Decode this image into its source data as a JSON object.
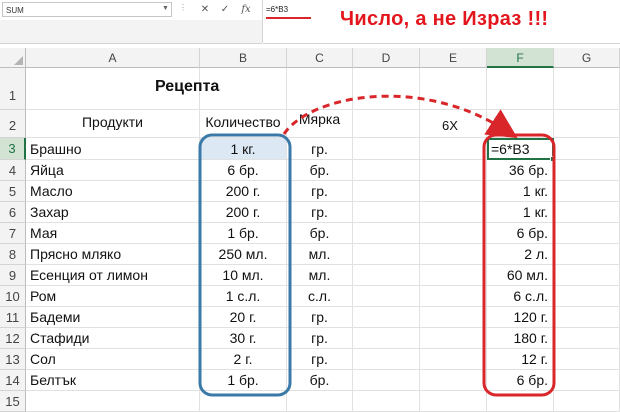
{
  "formula_bar": {
    "name_box": "SUM",
    "formula": "=6*B3",
    "cancel_icon": "✕",
    "enter_icon": "✓",
    "fx_label": "fx"
  },
  "annotation": "Число, а не Израз !!!",
  "columns": [
    "A",
    "B",
    "C",
    "D",
    "E",
    "F",
    "G"
  ],
  "rows": [
    "1",
    "2",
    "3",
    "4",
    "5",
    "6",
    "7",
    "8",
    "9",
    "10",
    "11",
    "12",
    "13",
    "14",
    "15"
  ],
  "sheet": {
    "title": "Рецепта",
    "header_products": "Продукти",
    "header_quantity": "Количество",
    "header_measure": "Мярка",
    "multiplier_label": "6X",
    "active_cell_formula": "=6*B3",
    "products": [
      {
        "name": "Брашно",
        "qty": "1 кг.",
        "unit": "гр.",
        "result": ""
      },
      {
        "name": "Яйца",
        "qty": "6 бр.",
        "unit": "бр.",
        "result": "36 бр."
      },
      {
        "name": "Масло",
        "qty": "200 г.",
        "unit": "гр.",
        "result": "1 кг."
      },
      {
        "name": "Захар",
        "qty": "200 г.",
        "unit": "гр.",
        "result": "1 кг."
      },
      {
        "name": "Мая",
        "qty": "1 бр.",
        "unit": "бр.",
        "result": "6 бр."
      },
      {
        "name": "Прясно мляко",
        "qty": "250 мл.",
        "unit": "мл.",
        "result": "2 л."
      },
      {
        "name": "Есенция от лимон",
        "qty": "10 мл.",
        "unit": "мл.",
        "result": "60 мл."
      },
      {
        "name": "Ром",
        "qty": "1 с.л.",
        "unit": "с.л.",
        "result": "6 с.л."
      },
      {
        "name": "Бадеми",
        "qty": "20 г.",
        "unit": "гр.",
        "result": "120 г."
      },
      {
        "name": "Стафиди",
        "qty": "30 г.",
        "unit": "гр.",
        "result": "180 г."
      },
      {
        "name": "Сол",
        "qty": "2 г.",
        "unit": "гр.",
        "result": "12 г."
      },
      {
        "name": "Белтък",
        "qty": "1 бр.",
        "unit": "бр.",
        "result": "6 бр."
      }
    ]
  },
  "colors": {
    "excel_green": "#217346",
    "annotation_red": "#e3161d",
    "highlight_blue": "#3b7aa8"
  }
}
